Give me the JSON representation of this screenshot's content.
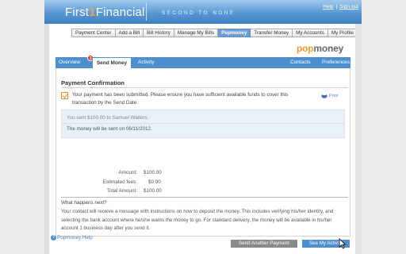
{
  "header": {
    "logo_first": "First",
    "logo_one": "1",
    "logo_financial": "Financial",
    "tagline": "SECOND TO NONE",
    "help": "Help",
    "sign_out": "Sign out"
  },
  "nav": {
    "items": [
      "Payment Center",
      "Add a Bill",
      "Bill History",
      "Manage My Bills",
      "Popmoney",
      "Transfer Money",
      "My Accounts",
      "My Profile"
    ],
    "active": "Popmoney"
  },
  "brand": {
    "pop": "pop",
    "money": "money",
    "color": "#f39a2b"
  },
  "tabs": {
    "overview": "Overview",
    "badge": "3",
    "send_money": "Send Money",
    "activity": "Activity",
    "contacts": "Contacts",
    "preferences": "Preferences"
  },
  "confirmation": {
    "title": "Payment Confirmation",
    "message": "Your payment has been submitted. Please ensure you have sufficient available funds to cover this transaction by the Send Date.",
    "print": "Print",
    "sent_to": "You sent $100.00 to Samuel Walters",
    "send_date": "The money will be sent on 06/11/2012."
  },
  "amounts": {
    "amount_label": "Amount:",
    "amount_value": "$100.00",
    "fees_label": "Estimated fees:",
    "fees_value": "$0.00",
    "total_label": "Total Amount:",
    "total_value": "$100.00"
  },
  "next": {
    "title": "What happens next?",
    "text": "Your contact will receive a message with instructions on how to deposit the money. This includes verifying his/her identity, and selecting the bank account where he/she wants the money to go. For standard delivery, the money will be available in his/her account 1 business day after you send it."
  },
  "buttons": {
    "send_another": "Send Another Payment",
    "see_activity": "See My Activity"
  },
  "footer": {
    "help": "Popmoney Help"
  }
}
